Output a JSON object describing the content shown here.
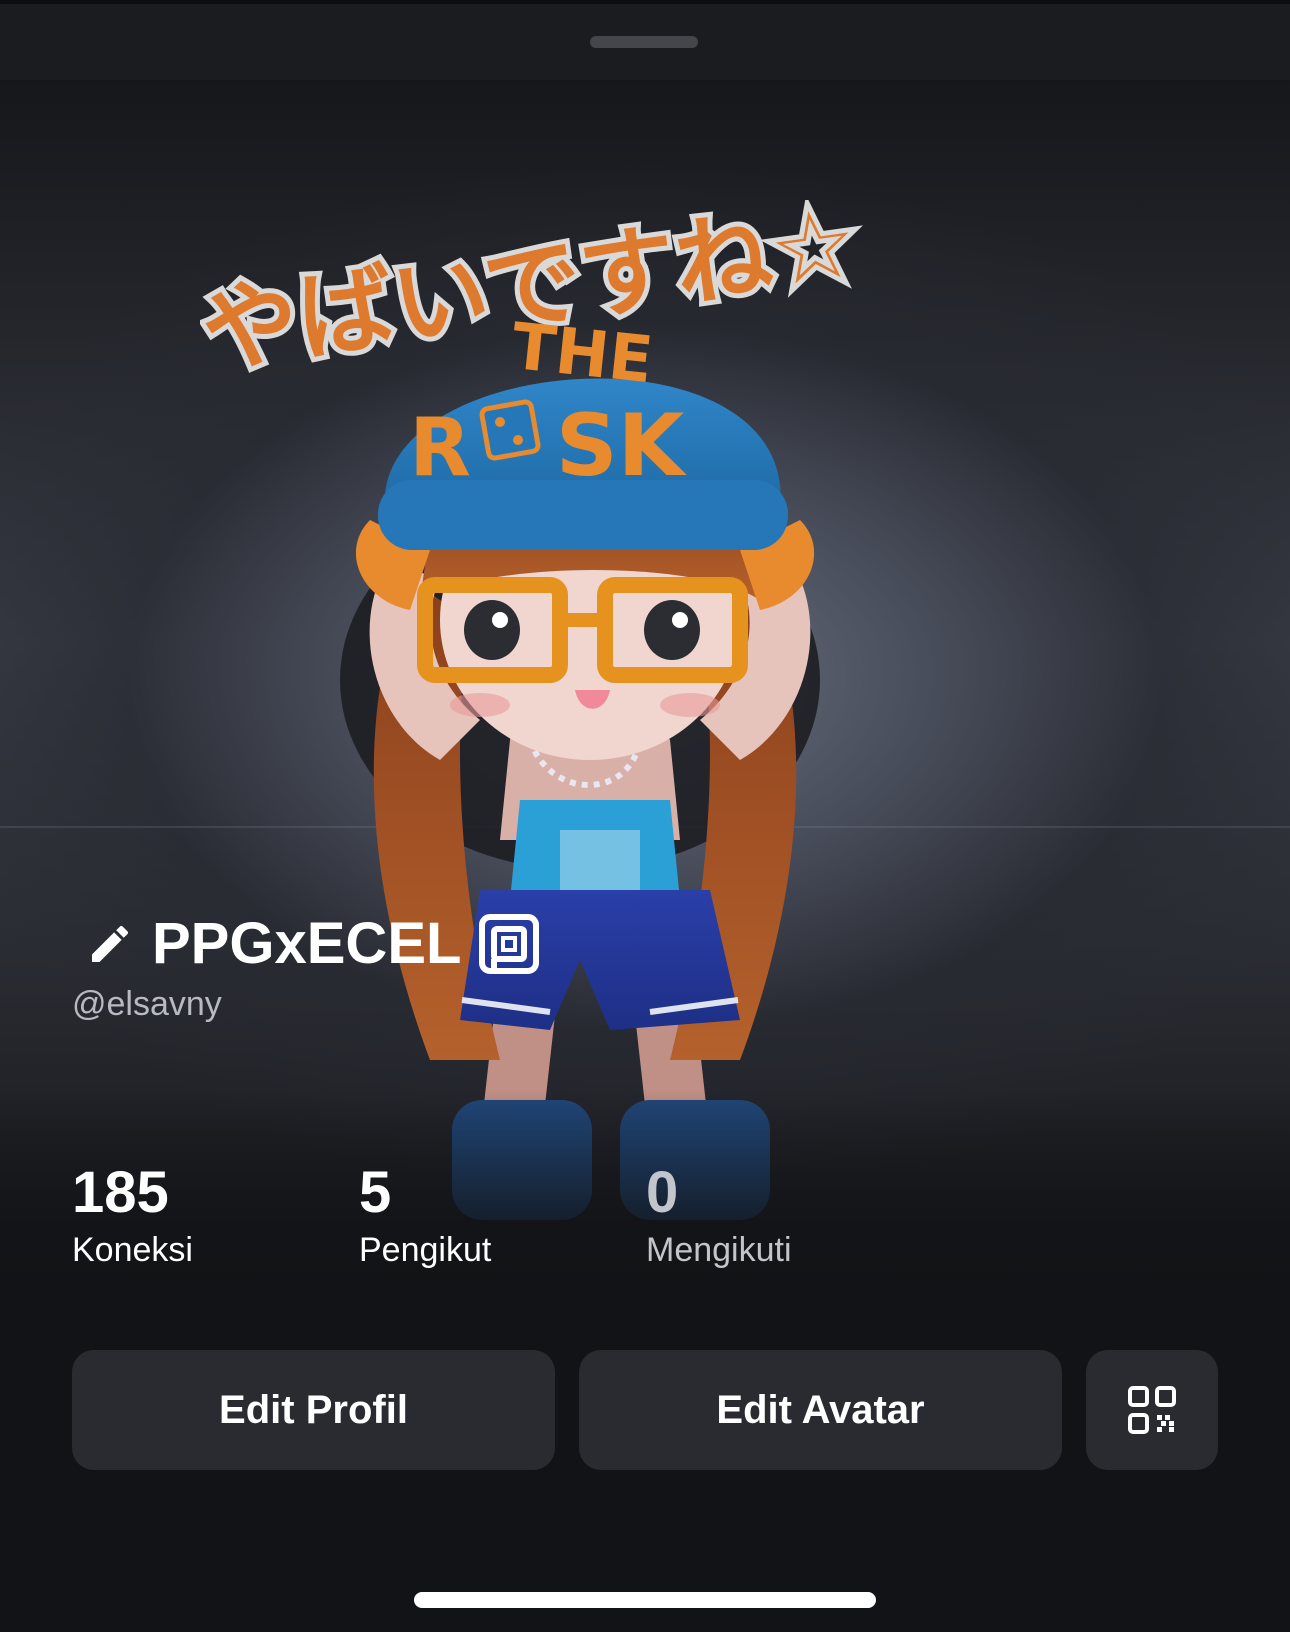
{
  "profile": {
    "display_name": "PPGxECEL",
    "username": "@elsavny",
    "avatar_caption": "やばいですね☆",
    "hat_text_top": "THE",
    "hat_text_bottom": "R",
    "hat_text_bottom_end": "SK"
  },
  "stats": [
    {
      "value": "185",
      "label": "Koneksi"
    },
    {
      "value": "5",
      "label": "Pengikut"
    },
    {
      "value": "0",
      "label": "Mengikuti"
    }
  ],
  "actions": {
    "edit_profile_label": "Edit Profil",
    "edit_avatar_label": "Edit Avatar",
    "qr_icon": "qr-code-icon"
  },
  "icons": {
    "edit_name": "pencil-icon",
    "badge": "verified-badge-icon"
  },
  "colors": {
    "background": "#121316",
    "button": "#2a2b30",
    "text_primary": "#ffffff",
    "text_secondary": "#b8bac2",
    "hat_blue": "#2f7fc1",
    "accent_orange": "#e88a2e"
  }
}
